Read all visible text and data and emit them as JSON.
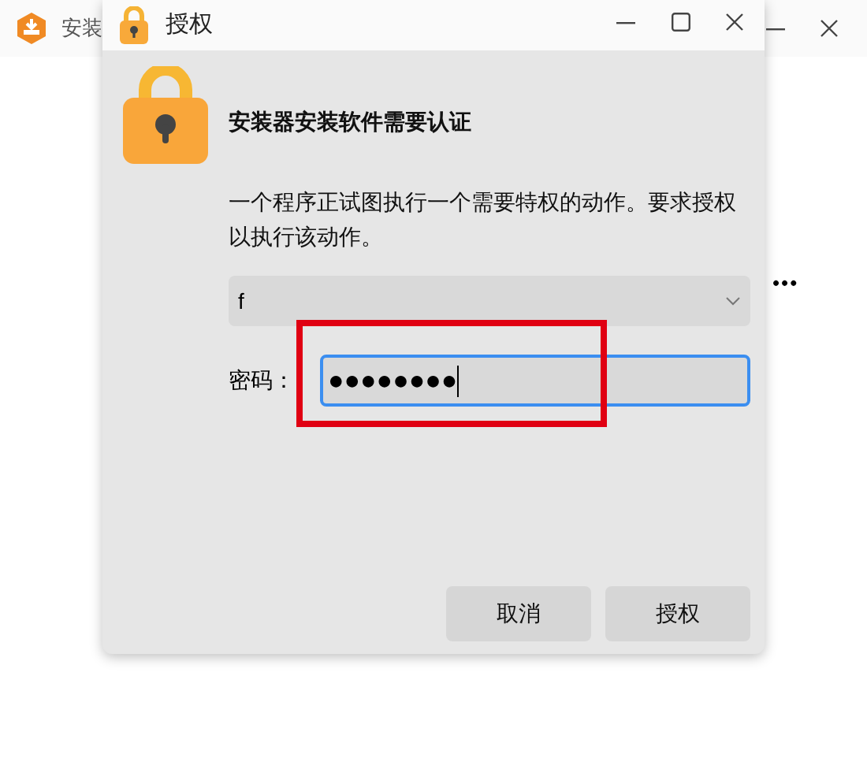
{
  "background_window": {
    "title": "安装",
    "fragment": "•••"
  },
  "dialog": {
    "title": "授权",
    "heading": "安装器安装软件需要认证",
    "message": "一个程序正试图执行一个需要特权的动作。要求授权以执行该动作。",
    "user_select": {
      "value": "f"
    },
    "password": {
      "label": "密码：",
      "value": "●●●●●●●●",
      "focused": true
    },
    "buttons": [
      {
        "label": "取消"
      },
      {
        "label": "授权"
      }
    ]
  }
}
